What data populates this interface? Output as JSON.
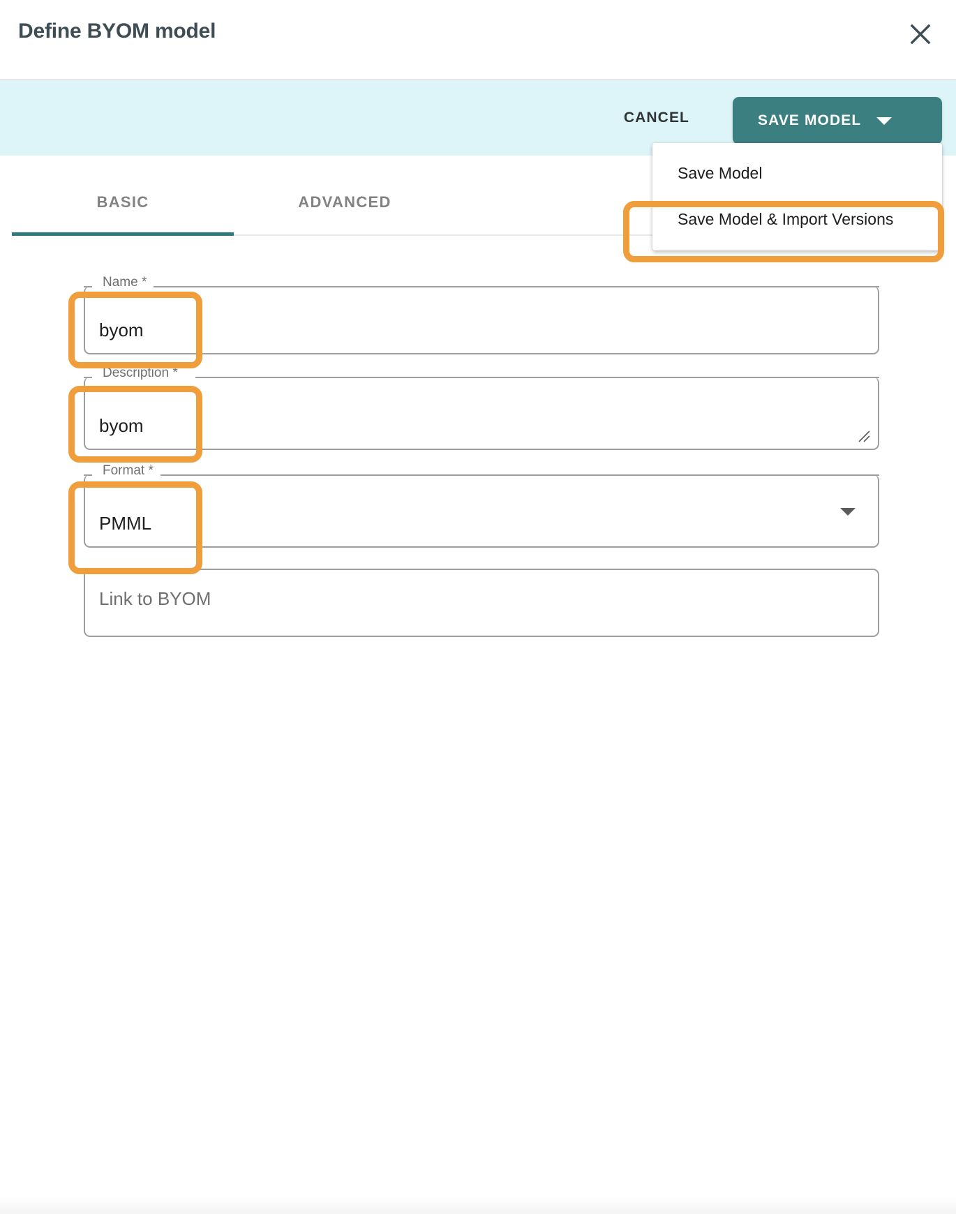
{
  "dialog": {
    "title": "Define BYOM model",
    "close_icon": "close-icon"
  },
  "toolbar": {
    "cancel_label": "CANCEL",
    "save_label": "SAVE MODEL",
    "save_caret_icon": "caret-down-icon",
    "background_color": "#ddf4f8",
    "accent_color": "#3c7f80"
  },
  "dropdown": {
    "items": [
      {
        "label": "Save Model"
      },
      {
        "label": "Save Model & Import Versions"
      }
    ],
    "highlighted_index": 1
  },
  "tabs": {
    "items": [
      {
        "label": "BASIC",
        "active": true
      },
      {
        "label": "ADVANCED",
        "active": false
      }
    ],
    "active_color": "#2d7b7e"
  },
  "form": {
    "fields": [
      {
        "label": "Name *",
        "value": "byom",
        "type": "text",
        "highlighted": true
      },
      {
        "label": "Description *",
        "value": "byom",
        "type": "textarea",
        "highlighted": true
      },
      {
        "label": "Format *",
        "value": "PMML",
        "type": "select",
        "highlighted": true
      },
      {
        "label": "",
        "placeholder": "Link to BYOM",
        "value": "",
        "type": "text",
        "highlighted": false
      }
    ]
  },
  "annotation": {
    "color": "#ef9e3b"
  }
}
